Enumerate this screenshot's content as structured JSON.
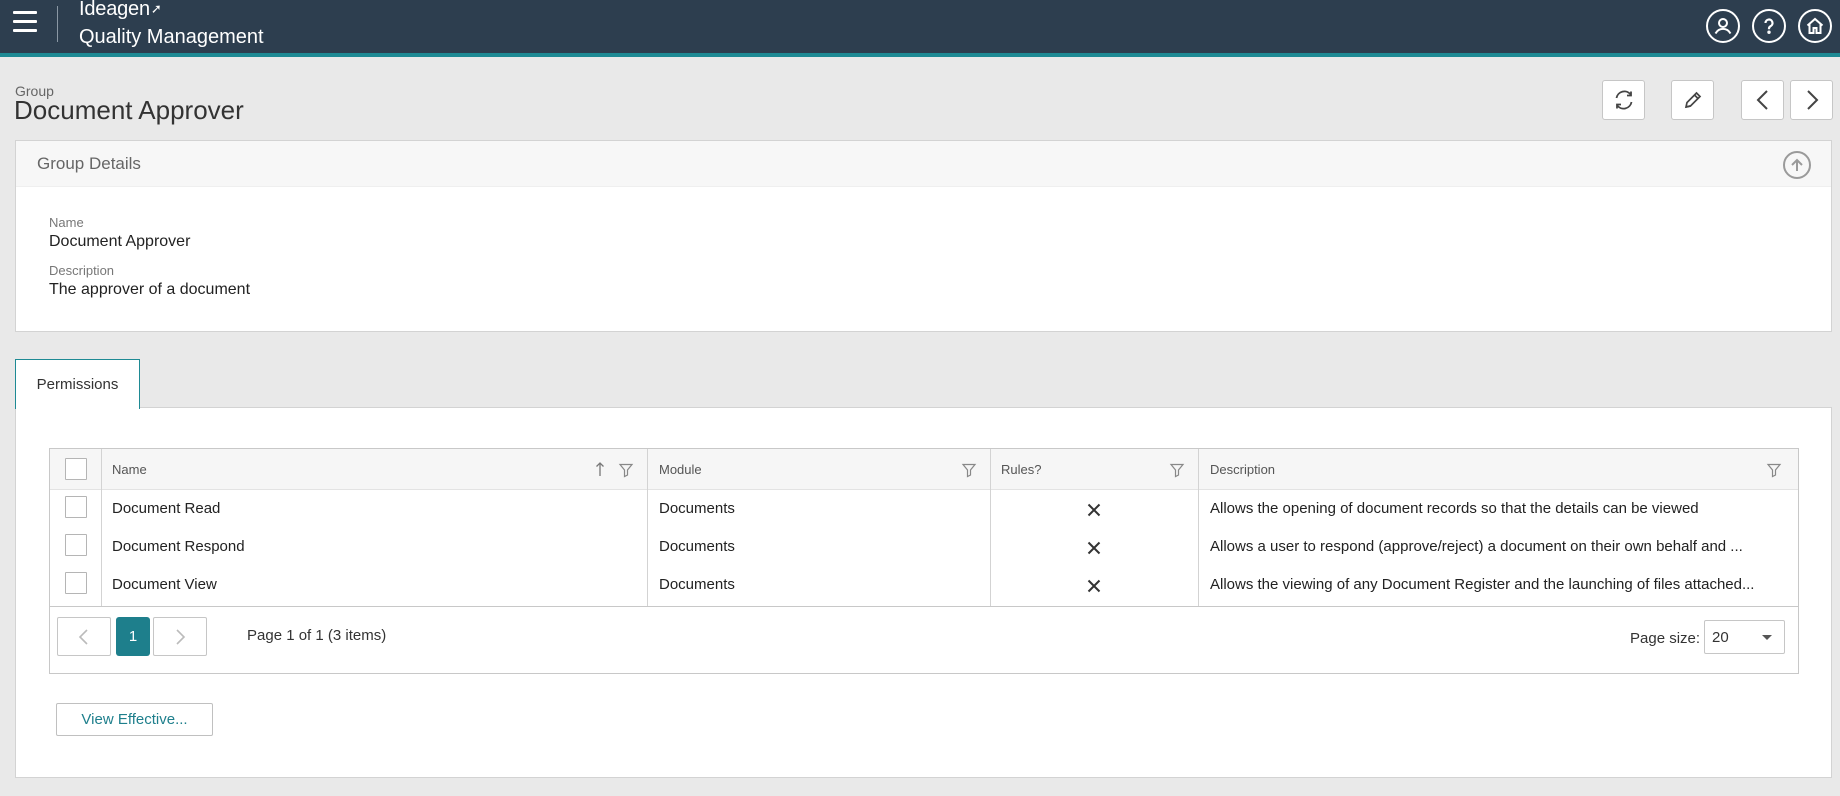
{
  "header": {
    "brand": "Ideagen",
    "app_name": "Quality Management",
    "icons": [
      "menu-icon",
      "user-icon",
      "help-icon",
      "home-icon"
    ]
  },
  "page": {
    "breadcrumb": "Group",
    "title": "Document Approver"
  },
  "details": {
    "title": "Group Details",
    "name_label": "Name",
    "name_value": "Document Approver",
    "description_label": "Description",
    "description_value": "The approver of a document"
  },
  "tabs": [
    {
      "label": "Permissions",
      "active": true
    }
  ],
  "grid": {
    "columns": [
      "Name",
      "Module",
      "Rules?",
      "Description"
    ],
    "rows": [
      {
        "name": "Document Read",
        "module": "Documents",
        "rules": false,
        "description": "Allows the opening of document records so that the details can be viewed"
      },
      {
        "name": "Document Respond",
        "module": "Documents",
        "rules": false,
        "description": "Allows a user to respond (approve/reject) a document on their own behalf and ..."
      },
      {
        "name": "Document View",
        "module": "Documents",
        "rules": false,
        "description": "Allows the viewing of any Document Register and the launching of files attached..."
      }
    ]
  },
  "pager": {
    "current_page": "1",
    "info": "Page 1 of 1 (3 items)",
    "page_size_label": "Page size:",
    "page_size": "20"
  },
  "actions": {
    "view_effective": "View Effective..."
  },
  "colors": {
    "header_bg": "#2d3e4f",
    "accent": "#1e8a94",
    "page_bg": "#e9e9e9"
  }
}
